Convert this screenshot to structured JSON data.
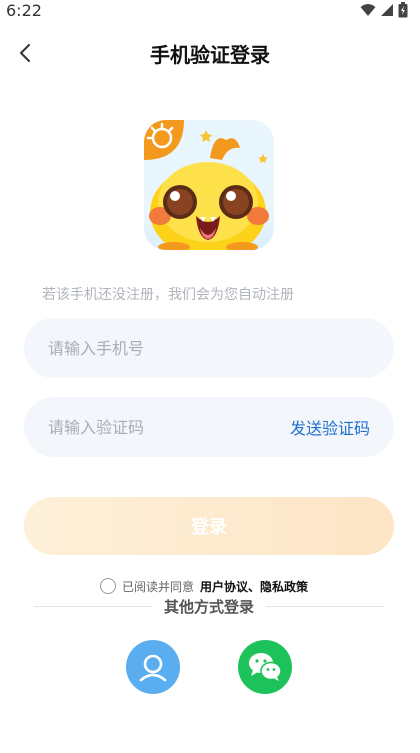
{
  "status_bar": {
    "time": "6:22"
  },
  "header": {
    "title": "手机验证登录"
  },
  "hint": "若该手机还没注册，我们会为您自动注册",
  "phone_field": {
    "placeholder": "请输入手机号",
    "value": ""
  },
  "code_field": {
    "placeholder": "请输入验证码",
    "value": "",
    "send_label": "发送验证码"
  },
  "login_button": {
    "label": "登录"
  },
  "agreement": {
    "text": "已阅读并同意",
    "links": "用户协议、隐私政策",
    "checked": false
  },
  "other_login": {
    "label": "其他方式登录"
  },
  "colors": {
    "accent_blue": "#1f6fd1",
    "login_gradient_start": "#fdf0d8",
    "login_gradient_end": "#fde5c6",
    "account_button": "#5aaef0",
    "wechat_button": "#1ec25a",
    "field_bg": "#f3f6fa"
  },
  "icons": {
    "back": "chevron-left-icon",
    "wifi": "wifi-icon",
    "signal": "signal-icon",
    "battery": "battery-icon",
    "account": "person-icon",
    "wechat": "wechat-icon"
  }
}
